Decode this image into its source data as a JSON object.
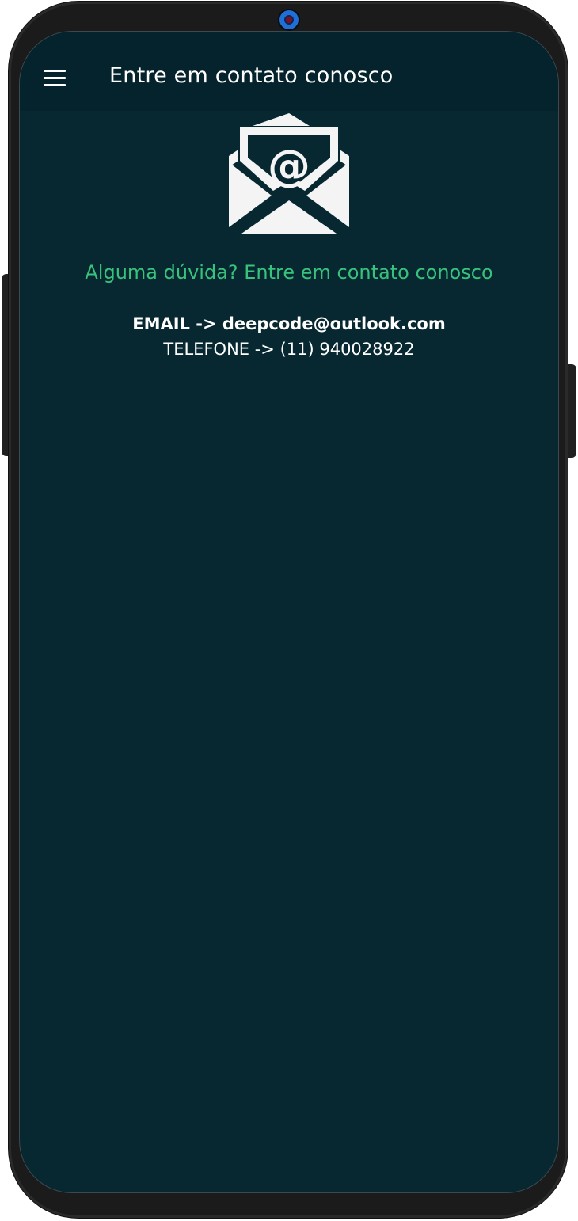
{
  "appbar": {
    "title": "Entre em contato conosco",
    "menu_icon": "hamburger-menu-icon"
  },
  "content": {
    "hero_icon": "envelope-at-icon",
    "subtitle": "Alguma dúvida? Entre em contato conosco",
    "email_line": "EMAIL -> deepcode@outlook.com",
    "phone_line": "TELEFONE -> (11) 940028922"
  },
  "colors": {
    "screen_background": "#072731",
    "appbar_background": "#05232c",
    "accent_green": "#38c37c",
    "text_white": "#ffffff"
  }
}
